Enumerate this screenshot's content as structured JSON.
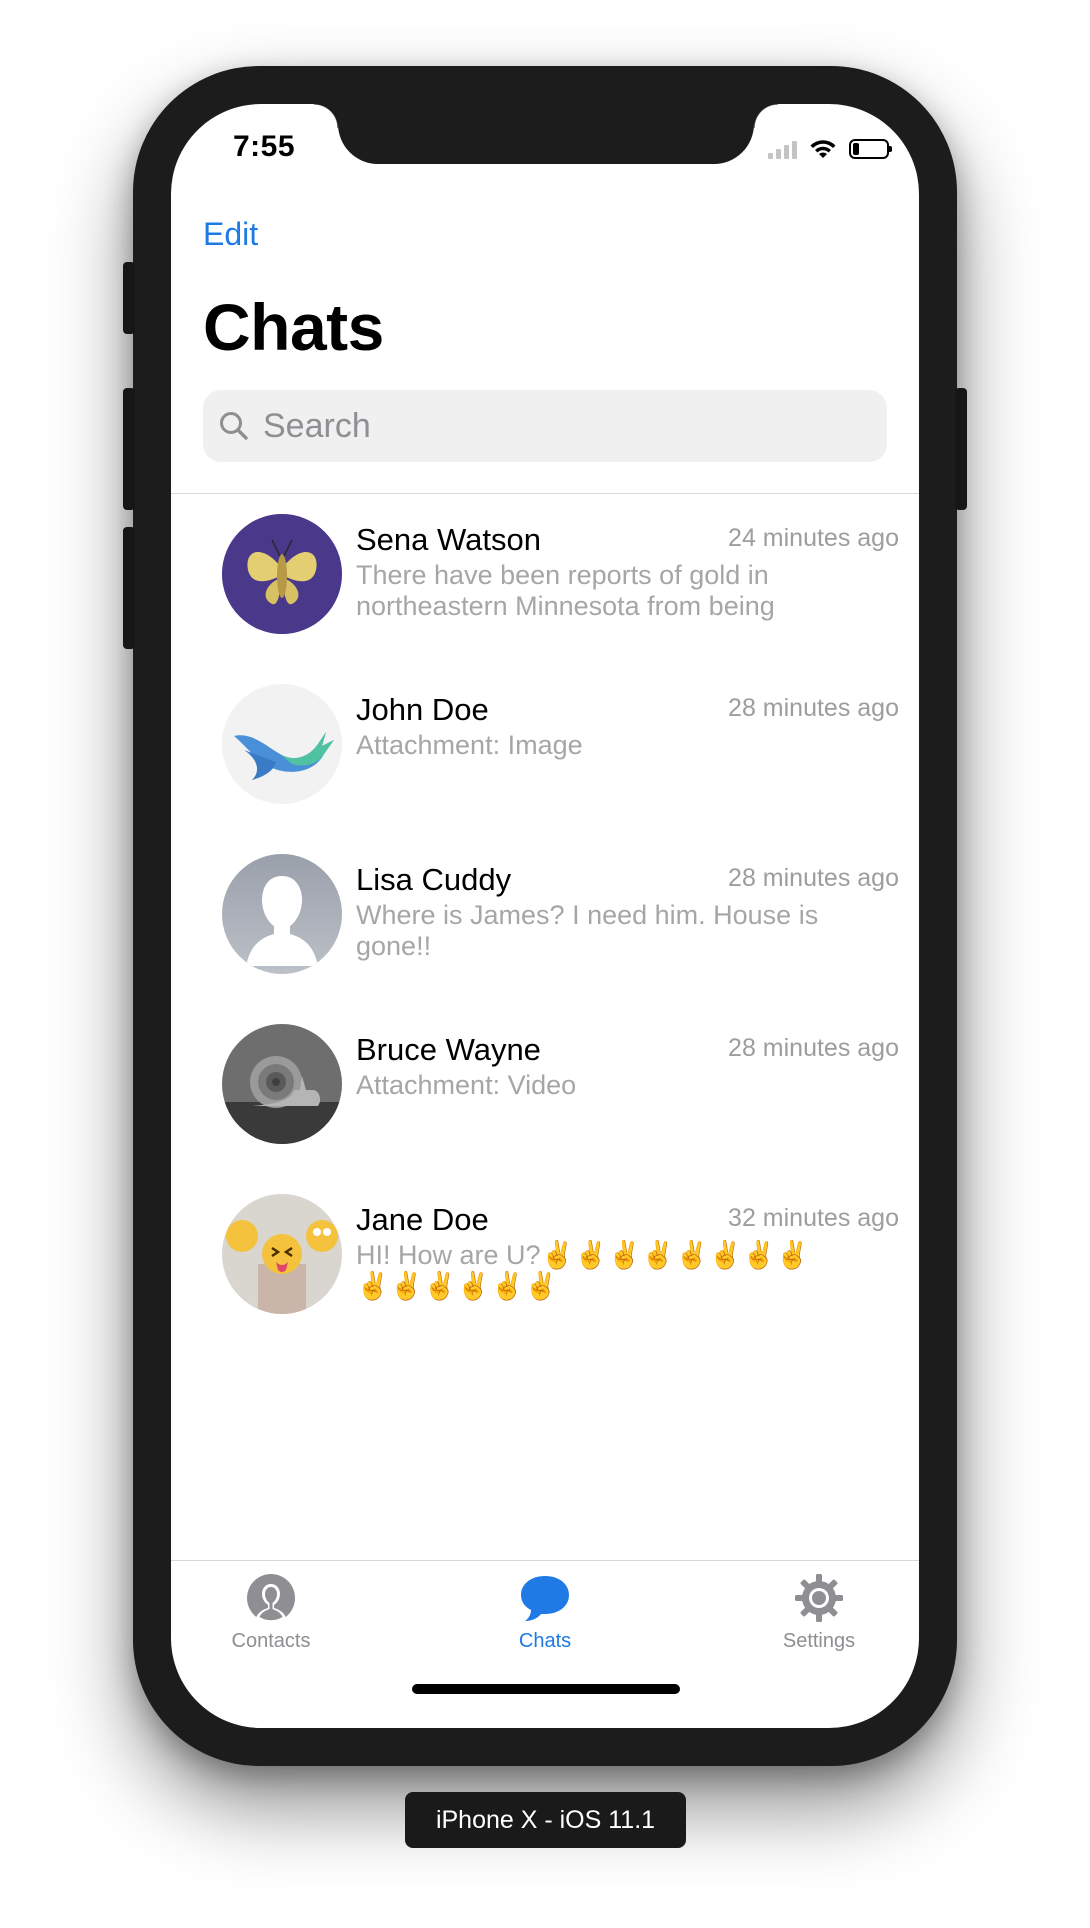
{
  "status_bar": {
    "time": "7:55",
    "icons": [
      "signal-icon",
      "wifi-icon",
      "battery-icon"
    ],
    "battery_level": 0.2
  },
  "nav": {
    "edit_label": "Edit",
    "title": "Chats",
    "search_placeholder": "Search"
  },
  "chats": [
    {
      "name": "Sena Watson",
      "time": "24 minutes ago",
      "preview": "There have been reports of gold in northeastern Minnesota from being on…"
    },
    {
      "name": "John Doe",
      "time": "28 minutes ago",
      "preview": "Attachment: Image"
    },
    {
      "name": "Lisa Cuddy",
      "time": "28 minutes ago",
      "preview": "Where is James? I need him. House is gone!!"
    },
    {
      "name": "Bruce Wayne",
      "time": "28 minutes ago",
      "preview": "Attachment: Video"
    },
    {
      "name": "Jane Doe",
      "time": "32 minutes ago",
      "preview": "HI! How are U?✌️✌️✌️✌️✌️✌️✌️✌️✌️✌️✌️✌️✌️✌️"
    }
  ],
  "tabs": [
    {
      "label": "Contacts",
      "icon": "person-circle-icon",
      "active": false
    },
    {
      "label": "Chats",
      "icon": "chat-bubble-icon",
      "active": true
    },
    {
      "label": "Settings",
      "icon": "gear-icon",
      "active": false
    }
  ],
  "device_label": "iPhone X - iOS 11.1",
  "colors": {
    "accent": "#1f7ae6",
    "secondary_text": "#a6a6a6",
    "tab_inactive": "#8e8e93",
    "frame": "#1c1c1c"
  }
}
